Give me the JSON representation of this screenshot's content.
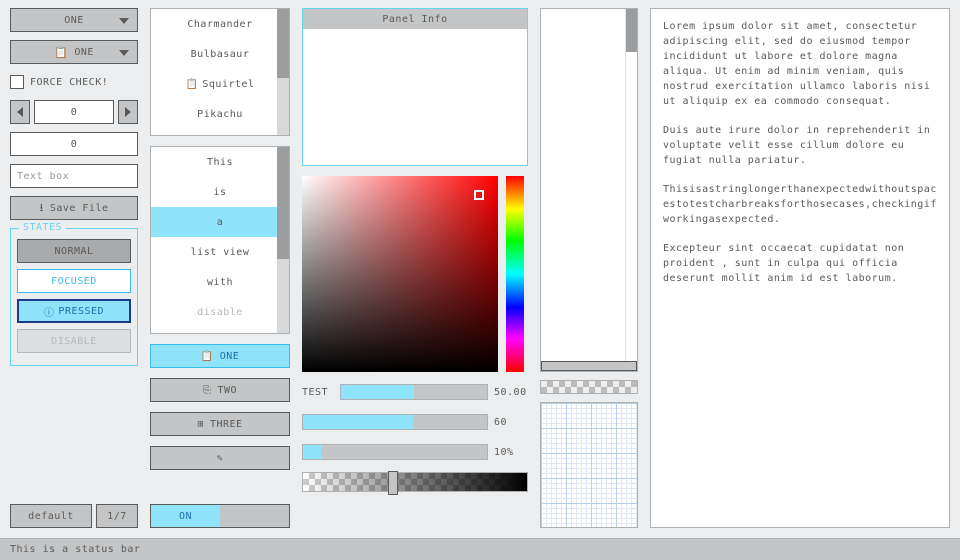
{
  "colA": {
    "dropdown1": "ONE",
    "dropdown2": "ONE",
    "checkbox_label": "FORCE CHECK!",
    "spinner_value": "0",
    "numeric_value": "0",
    "textbox_placeholder": "Text box",
    "save_label": "Save File",
    "states_legend": "STATES",
    "states": {
      "normal": "NORMAL",
      "focused": "FOCUSED",
      "pressed": "PRESSED",
      "disable": "DISABLE"
    },
    "pager": {
      "label": "default",
      "page": "1/7"
    }
  },
  "colB": {
    "list1": [
      "Charmander",
      "Bulbasaur",
      "Squirtel",
      "Pikachu"
    ],
    "list2": [
      "This",
      "is",
      "a",
      "list view",
      "with",
      "disable"
    ],
    "list2_selected_index": 2,
    "list2_disabled_index": 5,
    "iconbtns": [
      "ONE",
      "TWO",
      "THREE"
    ],
    "iconbtns_selected": 0,
    "toggle_label": "ON"
  },
  "colC": {
    "panel_title": "Panel Info",
    "slider_label": "TEST",
    "slider1_value": "50.00",
    "slider2_value": "60",
    "slider3_value": "10%",
    "slider1_pct": 50,
    "slider2_pct": 60,
    "slider3_pct": 10,
    "grad_knob_pct": 38
  },
  "colE": {
    "paragraphs": [
      "Lorem ipsum dolor sit amet, consectetur adipiscing elit, sed do eiusmod tempor incididunt ut labore et dolore magna aliqua. Ut enim ad minim veniam, quis nostrud exercitation ullamco laboris nisi ut aliquip ex ea commodo consequat.",
      "Duis aute irure dolor in reprehenderit in voluptate velit esse cillum dolore eu fugiat nulla pariatur.",
      "Thisisastringlongerthanexpectedwithoutspacestotestcharbreaksforthosecases,checkingifworkingasexpected.",
      "Excepteur sint occaecat cupidatat non proident , sunt in culpa qui officia deserunt mollit anim id est laborum."
    ]
  },
  "status": "This is a status bar"
}
